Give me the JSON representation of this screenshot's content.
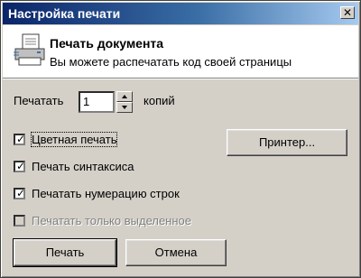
{
  "window": {
    "title": "Настройка печати",
    "close_symbol": "✕"
  },
  "header": {
    "title": "Печать документа",
    "subtitle": "Вы можете распечатать код своей страницы",
    "icon": "printer-document-icon"
  },
  "copies": {
    "label_before": "Печатать",
    "value": "1",
    "label_after": "копий"
  },
  "options": [
    {
      "label": "Цветная печать",
      "checked": true,
      "enabled": true,
      "focused": true
    },
    {
      "label": "Печать синтаксиса",
      "checked": true,
      "enabled": true,
      "focused": false
    },
    {
      "label": "Печатать нумерацию строк",
      "checked": true,
      "enabled": true,
      "focused": false
    },
    {
      "label": "Печатать только выделенное",
      "checked": false,
      "enabled": false,
      "focused": false
    }
  ],
  "buttons": {
    "printer": "Принтер...",
    "print": "Печать",
    "cancel": "Отмена"
  },
  "check_mark": "✓"
}
